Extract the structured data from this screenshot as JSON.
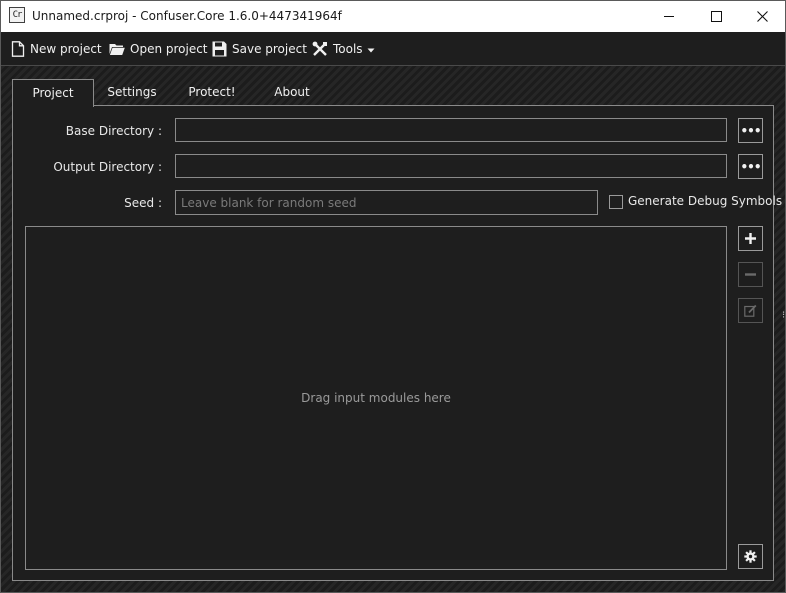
{
  "window": {
    "title": "Unnamed.crproj - Confuser.Core 1.6.0+447341964f",
    "icon_text": "Cr"
  },
  "toolbar": {
    "new_project": "New project",
    "open_project": "Open project",
    "save_project": "Save project",
    "tools": "Tools"
  },
  "tabs": [
    {
      "label": "Project",
      "active": true
    },
    {
      "label": "Settings",
      "active": false
    },
    {
      "label": "Protect!",
      "active": false
    },
    {
      "label": "About",
      "active": false
    }
  ],
  "form": {
    "base_directory_label": "Base Directory :",
    "base_directory_value": "",
    "output_directory_label": "Output Directory :",
    "output_directory_value": "",
    "seed_label": "Seed :",
    "seed_value": "",
    "seed_placeholder": "Leave blank for random seed",
    "browse_button": "•••",
    "debug_symbols_label": "Generate Debug Symbols",
    "debug_symbols_checked": false
  },
  "modules": {
    "drop_hint": "Drag input modules here"
  },
  "colors": {
    "background": "#1e1e1e",
    "border": "#8a8a8a",
    "text": "#f0f0f0",
    "placeholder": "#7a7a7a"
  },
  "icons": {
    "new_project": "new-file-icon",
    "open_project": "open-folder-icon",
    "save_project": "floppy-disk-icon",
    "tools": "tools-icon",
    "add": "plus-icon",
    "remove": "minus-icon",
    "edit": "edit-icon",
    "settings": "gear-icon"
  }
}
